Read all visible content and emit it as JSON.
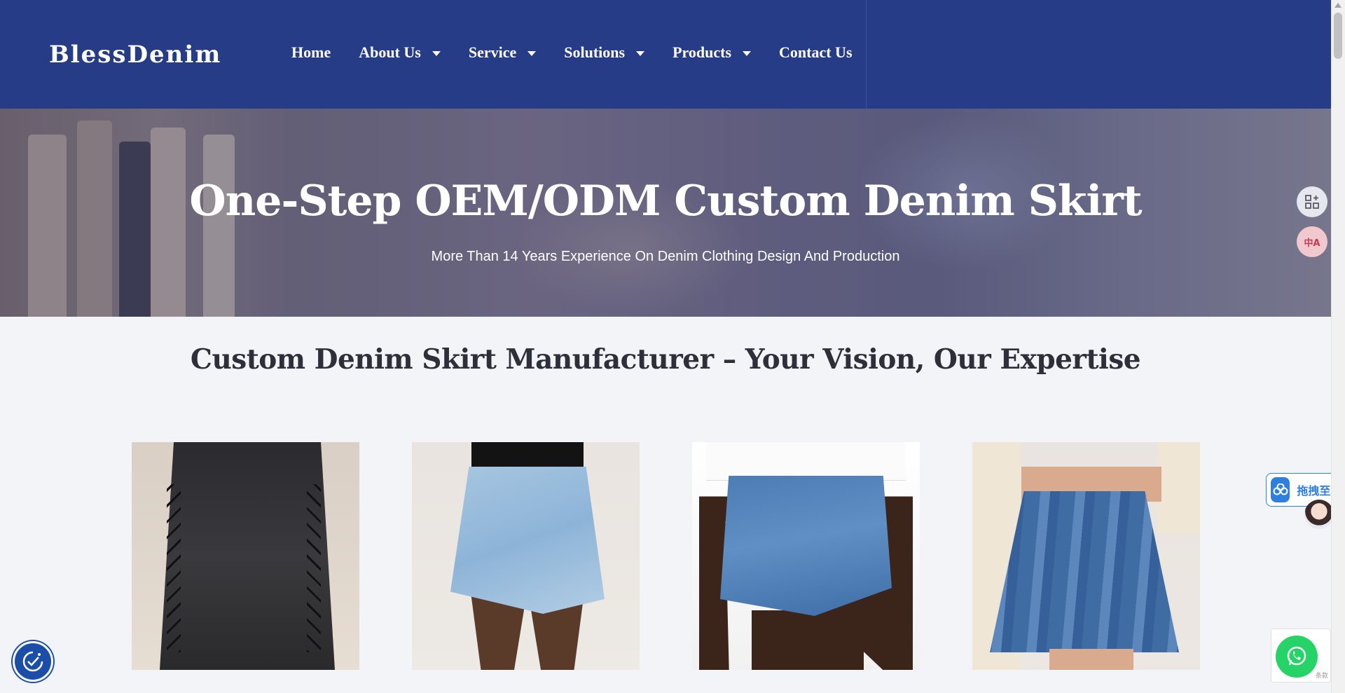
{
  "header": {
    "logo": "BlessDenim",
    "nav": [
      {
        "label": "Home"
      },
      {
        "label": "About Us"
      },
      {
        "label": "Service"
      },
      {
        "label": "Solutions"
      },
      {
        "label": "Products"
      },
      {
        "label": "Contact Us"
      }
    ]
  },
  "hero": {
    "title": "One-Step OEM/ODM Custom Denim Skirt",
    "subtitle": "More Than 14 Years Experience On Denim Clothing Design And Production"
  },
  "section": {
    "title": "Custom Denim Skirt Manufacturer – Your Vision, Our Expertise"
  },
  "widgets": {
    "grid_icon": "grid-plus-icon",
    "translate_label": "中A",
    "drag_text": "拖拽至此",
    "whatsapp_note": "条款",
    "colors": {
      "header": "#263c86",
      "whatsapp": "#25d366",
      "accent": "#2e7fe0"
    }
  }
}
